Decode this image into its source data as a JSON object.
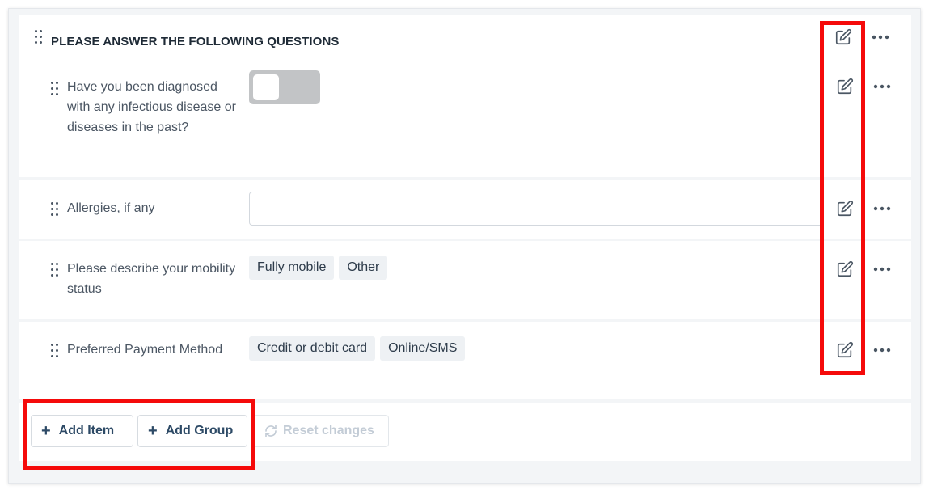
{
  "group": {
    "title": "PLEASE ANSWER THE FOLLOWING QUESTIONS"
  },
  "questions": [
    {
      "label": "Have you been diagnosed with any infectious disease or diseases in the past?",
      "type": "toggle",
      "value": "off"
    },
    {
      "label": "Allergies, if any",
      "type": "text",
      "value": ""
    },
    {
      "label": "Please describe your mobility status",
      "type": "choice",
      "options": [
        "Fully mobile",
        "Other"
      ]
    },
    {
      "label": "Preferred Payment Method",
      "type": "choice",
      "options": [
        "Credit or debit card",
        "Online/SMS"
      ]
    }
  ],
  "footer": {
    "add_item_label": "Add Item",
    "add_group_label": "Add Group",
    "reset_label": "Reset changes"
  },
  "colors": {
    "highlight": "#f50a0a",
    "button_text": "#2d4a66",
    "toggle_off": "#c2c4c6",
    "chip_bg": "#eef1f4"
  },
  "icons": {
    "edit": "edit-icon",
    "more": "more-horizontal-icon",
    "drag": "drag-handle-icon",
    "plus": "plus-icon",
    "reset": "refresh-icon"
  }
}
